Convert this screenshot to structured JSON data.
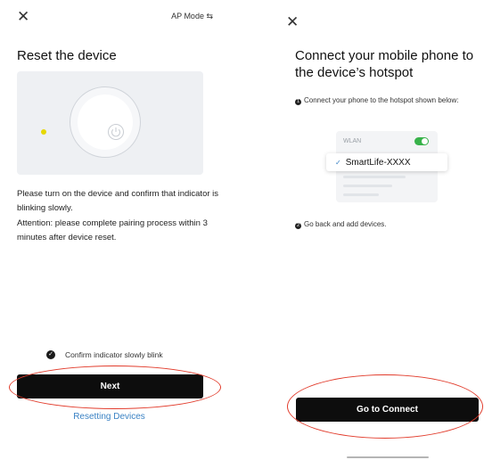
{
  "left_screen": {
    "close_icon": "✕",
    "ap_mode_label": "AP Mode ⇆",
    "title": "Reset the device",
    "instructions": [
      "Please turn on the device and confirm that indicator is blinking slowly.",
      "Attention: please complete pairing process within 3 minutes after device reset."
    ],
    "confirm_label": "Confirm indicator slowly blink",
    "confirm_checked": true,
    "next_label": "Next",
    "resetting_link": "Resetting Devices"
  },
  "right_screen": {
    "close_icon": "✕",
    "title": "Connect your mobile phone to the device’s hotspot",
    "step1_number": "1",
    "step1_text": "Connect your phone to the hotspot shown below:",
    "wlan_label": "WLAN",
    "ssid_check": "✓",
    "ssid_name": "SmartLife-XXXX",
    "step2_number": "2",
    "step2_text": "Go back and add devices.",
    "connect_label": "Go to Connect"
  },
  "colors": {
    "primary_button": "#0d0d0d",
    "link": "#3b82c4",
    "annotation_circle": "#e23c2c",
    "toggle_on": "#38b24a",
    "indicator_led": "#e6d800"
  }
}
